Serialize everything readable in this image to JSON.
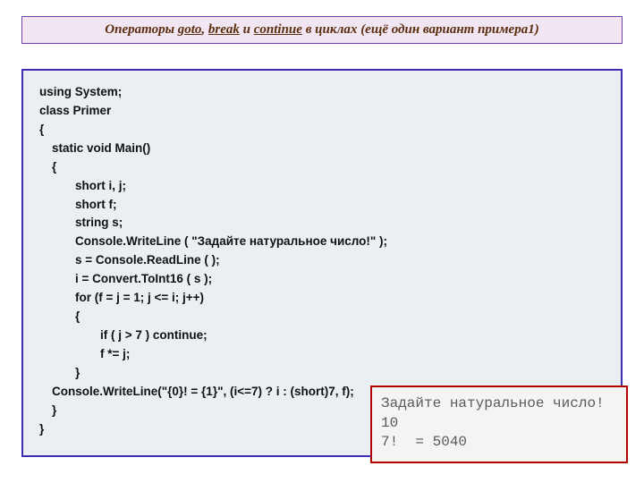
{
  "title": {
    "w1": "Операторы",
    "w2_u": "goto",
    "w3": ",",
    "w4_u": "break",
    "w5": "и",
    "w6_u": "continue",
    "w7": "в циклах",
    "w8": "(ещё один вариант примера1)"
  },
  "code": {
    "lines": [
      {
        "indent": 0,
        "text": "using System;"
      },
      {
        "indent": 0,
        "text": "class Primer"
      },
      {
        "indent": 0,
        "text": "{"
      },
      {
        "indent": 1,
        "text": "static void Main()"
      },
      {
        "indent": 1,
        "text": "{"
      },
      {
        "indent": 2,
        "text": "short i, j;"
      },
      {
        "indent": 2,
        "text": "short f;"
      },
      {
        "indent": 2,
        "text": "string s;"
      },
      {
        "indent": 2,
        "text": "Console.WriteLine ( \"Задайте натуральное число!\" );"
      },
      {
        "indent": 2,
        "text": "s = Console.ReadLine ( );"
      },
      {
        "indent": 2,
        "text": "i = Convert.ToInt16 ( s );"
      },
      {
        "indent": 2,
        "text": "for (f = j = 1; j <= i; j++)"
      },
      {
        "indent": 2,
        "text": "{"
      },
      {
        "indent": 3,
        "text": "if ( j > 7 ) continue;"
      },
      {
        "indent": 3,
        "text": "f *= j;"
      },
      {
        "indent": 2,
        "text": "}"
      },
      {
        "indent": 1,
        "text": "Console.WriteLine(\"{0}!  = {1}\",  (i<=7) ? i : (short)7, f);"
      },
      {
        "indent": 1,
        "text": "}"
      },
      {
        "indent": 0,
        "text": "}"
      }
    ]
  },
  "output": {
    "line1": "Задайте натуральное число!",
    "line2": "10",
    "line3": "7!  = 5040"
  }
}
